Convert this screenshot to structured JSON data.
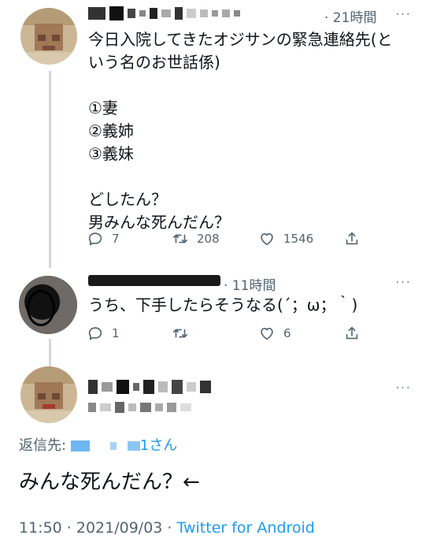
{
  "tweets": [
    {
      "time": "· 21時間",
      "more": "···",
      "text": "今日入院してきたオジサンの緊急連絡先(と\nいう名のお世話係)\n\n①妻\n②義姉\n③義妹\n\nどしたん？\n男みんな死んだん？",
      "replies": "7",
      "retweets": "208",
      "likes": "1546"
    },
    {
      "time": "· 11時間",
      "more": "···",
      "text": "うち、下手したらそうなる(´；ω；｀)",
      "replies": "1",
      "retweets": "",
      "likes": "6"
    }
  ],
  "main_tweet": {
    "more": "···",
    "reply_to_label": "返信先: ",
    "reply_to_suffix": "1さん",
    "text": "みんな死んだん？←",
    "timestamp": "11:50 · 2021/09/03 · ",
    "source": "Twitter for Android"
  },
  "icons": [
    "reply-icon",
    "retweet-icon",
    "like-icon",
    "share-icon",
    "more-icon"
  ],
  "colors": {
    "link": "#1d9bf0",
    "muted": "#536471",
    "text": "#0f1419",
    "thread_line": "#cfd9de"
  }
}
